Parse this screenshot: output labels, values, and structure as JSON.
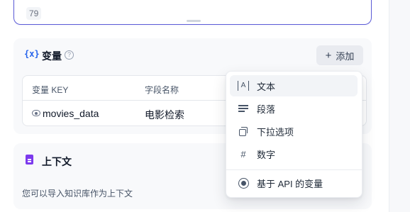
{
  "textarea": {
    "char_count": "79"
  },
  "variables": {
    "title_icon": "{x}",
    "title": "变量",
    "help_icon": "?",
    "add_button": {
      "plus": "+",
      "label": "添加"
    },
    "table": {
      "headers": [
        "变量 KEY",
        "字段名称"
      ],
      "rows": [
        {
          "key": "movies_data",
          "name": "电影检索"
        }
      ]
    }
  },
  "context": {
    "title": "上下文",
    "description": "您可以导入知识库作为上下文"
  },
  "dropdown": {
    "items": [
      {
        "icon": "text-icon",
        "label": "文本"
      },
      {
        "icon": "paragraph-icon",
        "label": "段落"
      },
      {
        "icon": "select-icon",
        "label": "下拉选项"
      },
      {
        "icon": "number-icon",
        "label": "数字",
        "glyph": "#"
      },
      {
        "icon": "api-icon",
        "label": "基于 API 的变量"
      }
    ],
    "text_icon_glyph": "A"
  },
  "colors": {
    "accent": "#5b5bd6",
    "variable_icon": "#2563eb",
    "context_icon": "#7c3aed"
  }
}
